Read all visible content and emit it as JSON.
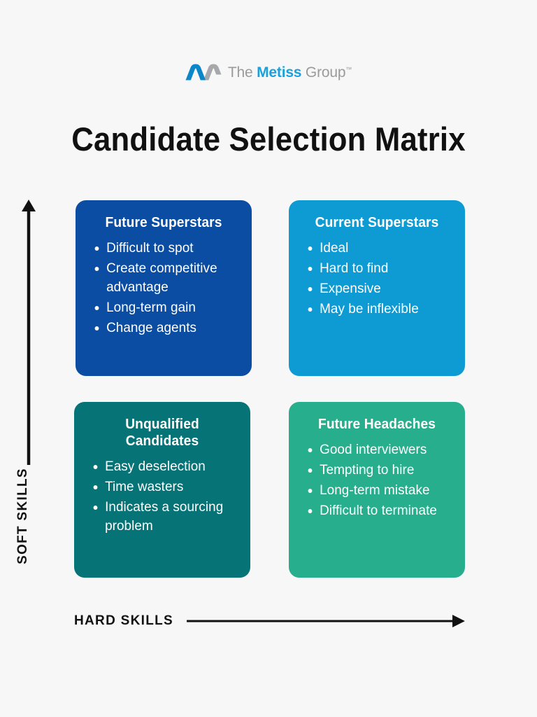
{
  "background_color": "#f7f7f7",
  "logo": {
    "mark_name": "metiss-m-logo",
    "mark_blue": "#0b86c9",
    "mark_gray": "#a6a8ab",
    "word_the": "The ",
    "word_metiss": "Metiss",
    "word_group": " Group",
    "trademark": "™",
    "gray_color": "#9b9b9b",
    "blue_color": "#1ba0db"
  },
  "header": {
    "title": "Candidate Selection Matrix"
  },
  "axes": {
    "y_label": "SOFT SKILLS",
    "x_label": "HARD SKILLS",
    "axis_color": "#111111"
  },
  "matrix": {
    "quadrants": [
      {
        "id": "future-superstars",
        "position": "top-left",
        "title": "Future Superstars",
        "color": "#0b4da2",
        "items": [
          "Difficult to spot",
          "Create competitive advantage",
          "Long-term gain",
          "Change agents"
        ]
      },
      {
        "id": "current-superstars",
        "position": "top-right",
        "title": "Current Superstars",
        "color": "#0e9bd4",
        "items": [
          "Ideal",
          "Hard to find",
          "Expensive",
          "May be inflexible"
        ]
      },
      {
        "id": "unqualified-candidates",
        "position": "bottom-left",
        "title": "Unqualified Candidates",
        "color": "#067377",
        "items": [
          "Easy deselection",
          "Time wasters",
          "Indicates a sourcing problem"
        ]
      },
      {
        "id": "future-headaches",
        "position": "bottom-right",
        "title": "Future Headaches",
        "color": "#27ae8d",
        "items": [
          "Good interviewers",
          "Tempting to hire",
          "Long-term mistake",
          "Difficult to terminate"
        ]
      }
    ]
  }
}
